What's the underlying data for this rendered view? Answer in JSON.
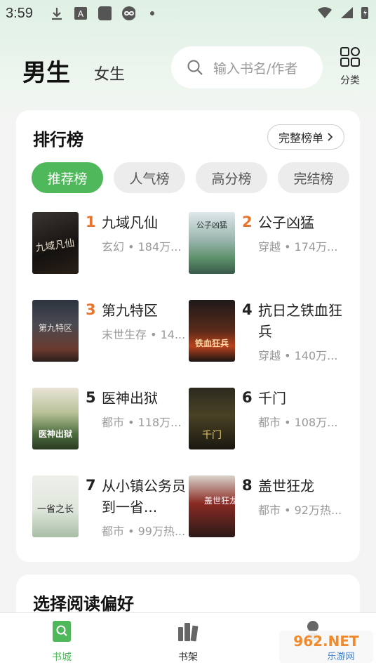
{
  "status_bar": {
    "time": "3:59"
  },
  "header": {
    "tab_male": "男生",
    "tab_female": "女生",
    "search_placeholder": "输入书名/作者",
    "category_label": "分类"
  },
  "ranking": {
    "title": "排行榜",
    "full_list_label": "完整榜单",
    "chips": [
      "推荐榜",
      "人气榜",
      "高分榜",
      "完结榜"
    ],
    "active_chip": "推荐榜",
    "books": [
      {
        "rank": "1",
        "title": "九域凡仙",
        "meta": "玄幻 • 184万..."
      },
      {
        "rank": "2",
        "title": "公子凶猛",
        "meta": "穿越 • 174万..."
      },
      {
        "rank": "3",
        "title": "第九特区",
        "meta": "末世生存 • 14..."
      },
      {
        "rank": "4",
        "title": "抗日之铁血狂兵",
        "meta": "穿越 • 140万..."
      },
      {
        "rank": "5",
        "title": "医神出狱",
        "meta": "都市 • 118万..."
      },
      {
        "rank": "6",
        "title": "千门",
        "meta": "都市 • 108万..."
      },
      {
        "rank": "7",
        "title": "从小镇公务员到一省...",
        "meta": "都市 • 99万热..."
      },
      {
        "rank": "8",
        "title": "盖世狂龙",
        "meta": "都市 • 92万热..."
      }
    ],
    "cover_texts": [
      "九域凡仙",
      "公子凶猛",
      "第九特区",
      "铁血狂兵",
      "医神出狱",
      "千门",
      "一省之长",
      "盖世狂龙"
    ]
  },
  "preference": {
    "title": "选择阅读偏好"
  },
  "bottom_nav": {
    "bookstore": "书城",
    "bookshelf": "书架"
  },
  "watermark": {
    "line1": "962.NET",
    "line2": "乐游网"
  },
  "colors": {
    "accent": "#4fb85a",
    "rank_hot": "#e9742c"
  }
}
